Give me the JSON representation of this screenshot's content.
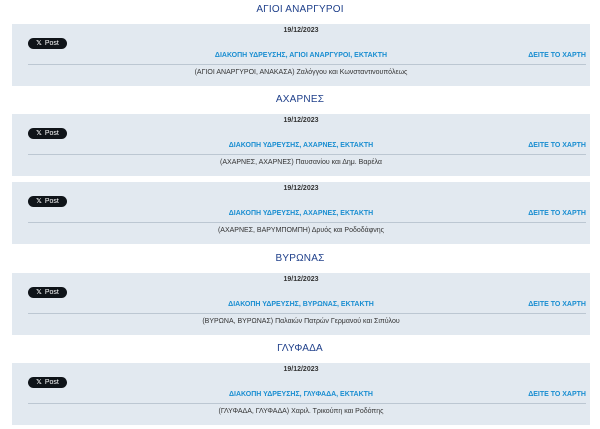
{
  "sections": [
    {
      "title": "ΑΓΙΟΙ ΑΝΑΡΓΥΡΟΙ",
      "items": [
        {
          "date": "19/12/2023",
          "post_label": "Post",
          "headline": "ΔΙΑΚΟΠΗ ΥΔΡΕΥΣΗΣ, ΑΓΙΟΙ ΑΝΑΡΓΥΡΟΙ, ΕΚΤΑΚΤΗ",
          "map_link": "ΔΕΙΤΕ ΤΟ ΧΑΡΤΗ",
          "street": "(ΑΓΙΟΙ ΑΝΑΡΓΥΡΟΙ, ΑΝΑΚΑΣΑ) Ζαλόγγου και Κωνσταντινουπόλεως"
        }
      ]
    },
    {
      "title": "ΑΧΑΡΝΕΣ",
      "items": [
        {
          "date": "19/12/2023",
          "post_label": "Post",
          "headline": "ΔΙΑΚΟΠΗ ΥΔΡΕΥΣΗΣ, ΑΧΑΡΝΕΣ, ΕΚΤΑΚΤΗ",
          "map_link": "ΔΕΙΤΕ ΤΟ ΧΑΡΤΗ",
          "street": "(ΑΧΑΡΝΕΣ, ΑΧΑΡΝΕΣ) Παυσανίου και Δημ. Βαρέλα"
        },
        {
          "date": "19/12/2023",
          "post_label": "Post",
          "headline": "ΔΙΑΚΟΠΗ ΥΔΡΕΥΣΗΣ, ΑΧΑΡΝΕΣ, ΕΚΤΑΚΤΗ",
          "map_link": "ΔΕΙΤΕ ΤΟ ΧΑΡΤΗ",
          "street": "(ΑΧΑΡΝΕΣ, ΒΑΡΥΜΠΟΜΠΗ) Δρυός και Ροδοδάφνης"
        }
      ]
    },
    {
      "title": "ΒΥΡΩΝΑΣ",
      "items": [
        {
          "date": "19/12/2023",
          "post_label": "Post",
          "headline": "ΔΙΑΚΟΠΗ ΥΔΡΕΥΣΗΣ, ΒΥΡΩΝΑΣ, ΕΚΤΑΚΤΗ",
          "map_link": "ΔΕΙΤΕ ΤΟ ΧΑΡΤΗ",
          "street": "(ΒΥΡΩΝΑ, ΒΥΡΩΝΑΣ) Παλαιών Πατρών Γερμανού και Σιπύλου"
        }
      ]
    },
    {
      "title": "ΓΛΥΦΑΔΑ",
      "items": [
        {
          "date": "19/12/2023",
          "post_label": "Post",
          "headline": "ΔΙΑΚΟΠΗ ΥΔΡΕΥΣΗΣ, ΓΛΥΦΑΔΑ, ΕΚΤΑΚΤΗ",
          "map_link": "ΔΕΙΤΕ ΤΟ ΧΑΡΤΗ",
          "street": "(ΓΛΥΦΑΔΑ, ΓΛΥΦΑΔΑ) Χαριλ. Τρικούπη και Ροδόπης"
        }
      ]
    }
  ]
}
